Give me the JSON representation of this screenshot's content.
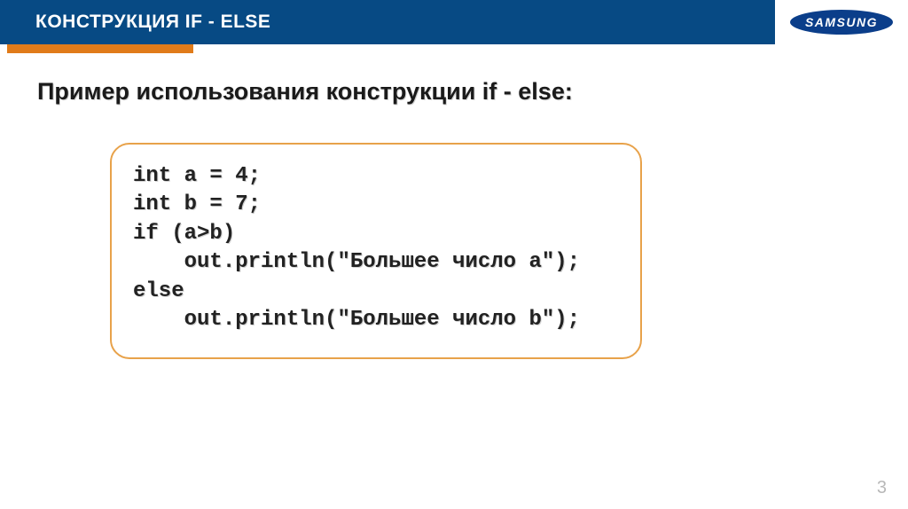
{
  "header": {
    "title": "КОНСТРУКЦИЯ IF - ELSE",
    "logo_text": "SAMSUNG"
  },
  "subtitle": "Пример использования конструкции if - else:",
  "code": {
    "line1": "int a = 4;",
    "line2": "int b = 7;",
    "line3": "if (a>b)",
    "line4": "    out.println(\"Большее число a\");",
    "line5": "else",
    "line6": "    out.println(\"Большее число b\");"
  },
  "page_number": "3"
}
